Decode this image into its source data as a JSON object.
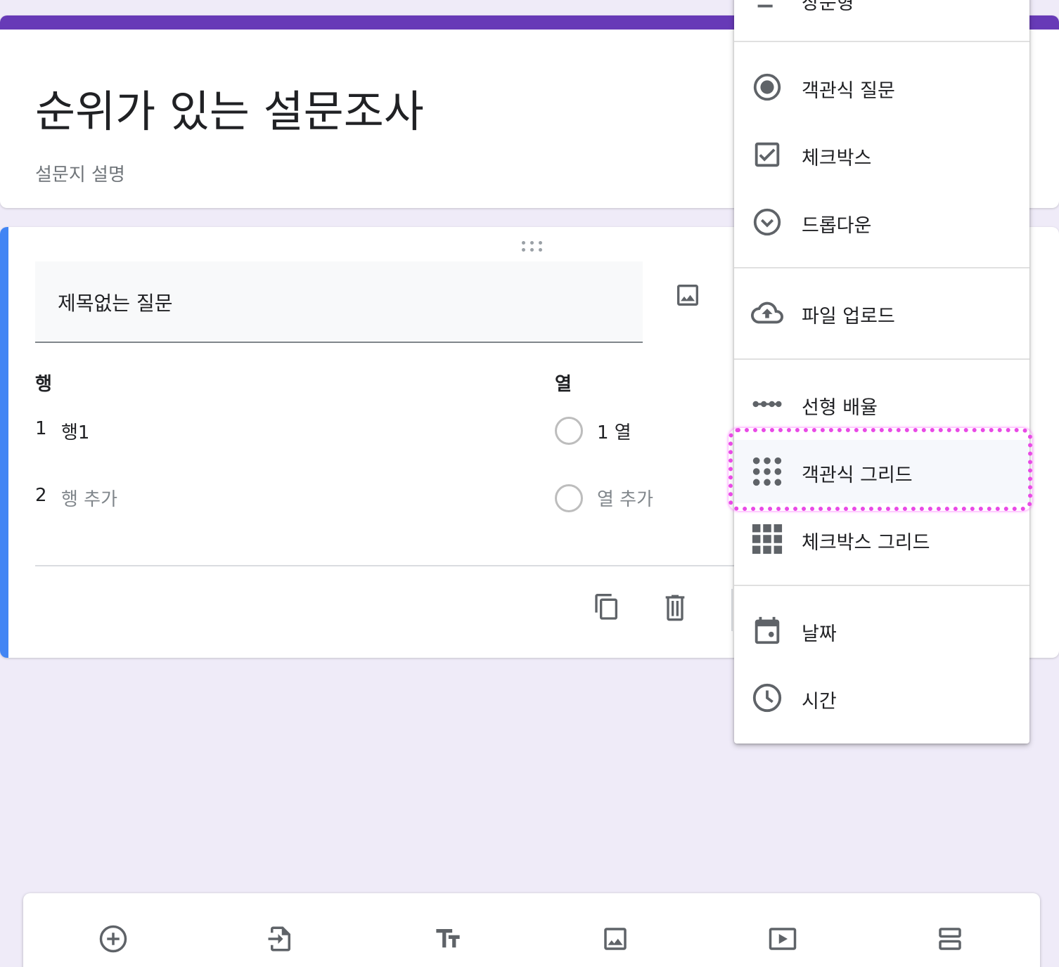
{
  "form": {
    "title": "순위가 있는 설문조사",
    "description_placeholder": "설문지 설명",
    "accent_color": "#673ab7"
  },
  "question": {
    "title": "제목없는 질문",
    "rows_label": "행",
    "columns_label": "열",
    "rows": [
      {
        "index": "1",
        "text": "행1"
      },
      {
        "index": "2",
        "text": "행 추가"
      }
    ],
    "columns": [
      {
        "text": "1 열"
      },
      {
        "text": "열 추가"
      }
    ],
    "accent_color": "#4285f4"
  },
  "type_menu": {
    "items": [
      {
        "label": "장문형",
        "icon": "paragraph-icon"
      },
      {
        "label": "객관식 질문",
        "icon": "radio-button-icon"
      },
      {
        "label": "체크박스",
        "icon": "checkbox-icon"
      },
      {
        "label": "드롭다운",
        "icon": "dropdown-icon"
      },
      {
        "label": "파일 업로드",
        "icon": "cloud-upload-icon"
      },
      {
        "label": "선형 배율",
        "icon": "linear-scale-icon"
      },
      {
        "label": "객관식 그리드",
        "icon": "dot-grid-icon"
      },
      {
        "label": "체크박스 그리드",
        "icon": "square-grid-icon"
      },
      {
        "label": "날짜",
        "icon": "calendar-icon"
      },
      {
        "label": "시간",
        "icon": "clock-icon"
      }
    ],
    "highlighted": "객관식 그리드",
    "highlight_color": "#e94ae6"
  },
  "footer_icons": [
    "copy-icon",
    "delete-icon"
  ],
  "toolbar_icons": [
    "add-question-icon",
    "import-questions-icon",
    "add-title-icon",
    "add-image-icon",
    "add-video-icon",
    "add-section-icon"
  ]
}
